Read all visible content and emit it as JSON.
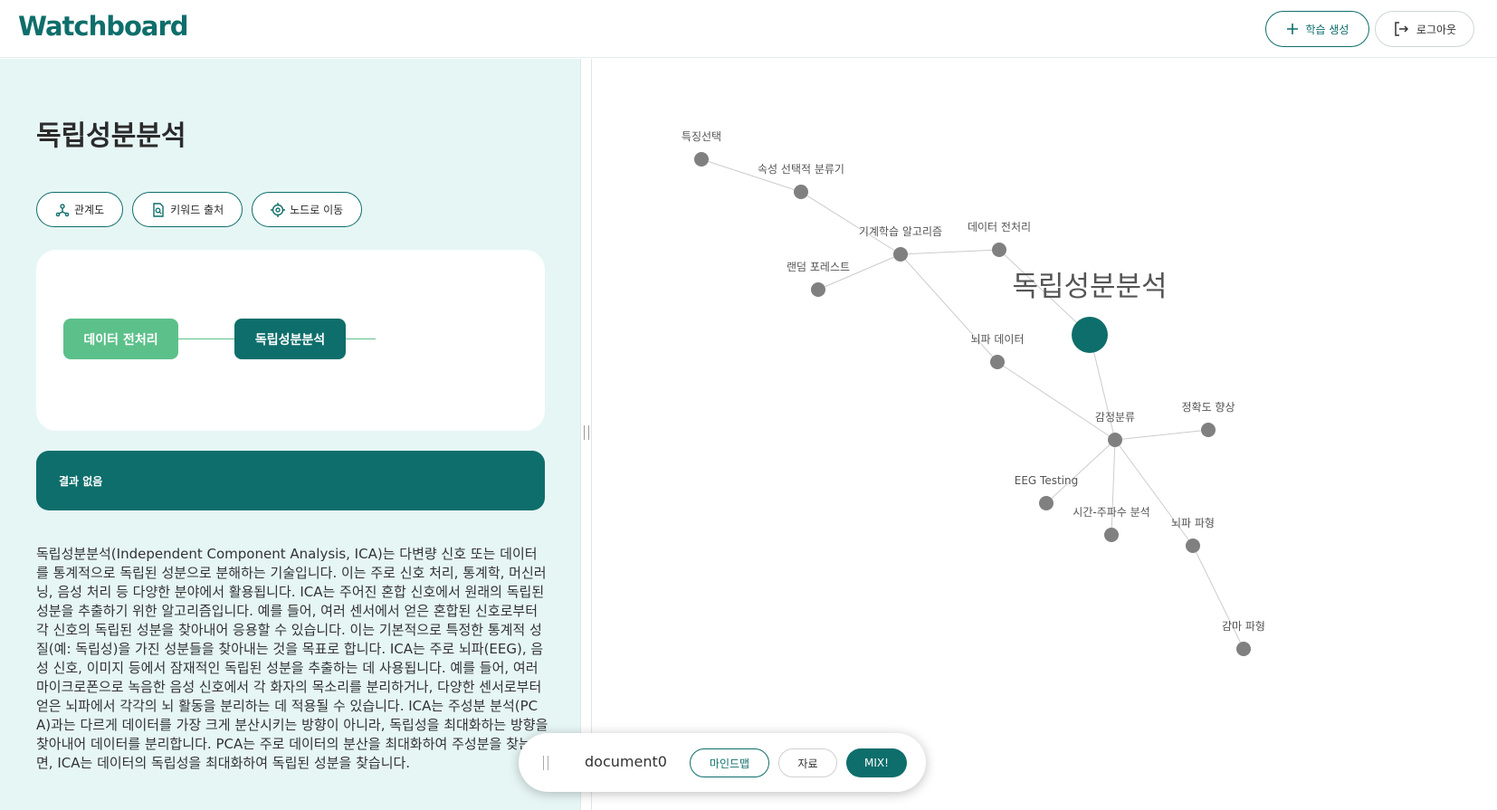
{
  "app": {
    "logo": "Watchboard"
  },
  "header": {
    "create_label": "학습 생성",
    "logout_label": "로그아웃"
  },
  "left": {
    "title": "독립성분분석",
    "actions": [
      {
        "label": "관계도",
        "icon": "hierarchy-icon"
      },
      {
        "label": "키워드 출처",
        "icon": "document-search-icon"
      },
      {
        "label": "노드로 이동",
        "icon": "target-icon"
      }
    ],
    "mindmap": {
      "parent": "데이터 전처리",
      "current": "독립성분분석"
    },
    "result_text": "결과 없음",
    "description": "독립성분분석(Independent Component Analysis, ICA)는 다변량 신호 또는 데이터를 통계적으로 독립된 성분으로 분해하는 기술입니다. 이는 주로 신호 처리, 통계학, 머신러닝, 음성 처리 등 다양한 분야에서 활용됩니다. ICA는 주어진 혼합 신호에서 원래의 독립된 성분을 추출하기 위한 알고리즘입니다. 예를 들어, 여러 센서에서 얻은 혼합된 신호로부터 각 신호의 독립된 성분을 찾아내어 응용할 수 있습니다. 이는 기본적으로 특정한 통계적 성질(예: 독립성)을 가진 성분들을 찾아내는 것을 목표로 합니다. ICA는 주로 뇌파(EEG), 음성 신호, 이미지 등에서 잠재적인 독립된 성분을 추출하는 데 사용됩니다. 예를 들어, 여러 마이크로폰으로 녹음한 음성 신호에서 각 화자의 목소리를 분리하거나, 다양한 센서로부터 얻은 뇌파에서 각각의 뇌 활동을 분리하는 데 적용될 수 있습니다. ICA는 주성분 분석(PCA)과는 다르게 데이터를 가장 크게 분산시키는 방향이 아니라, 독립성을 최대화하는 방향을 찾아내어 데이터를 분리합니다. PCA는 주로 데이터의 분산을 최대화하여 주성분을 찾는 반면, ICA는 데이터의 독립성을 최대화하여 독립된 성분을 찾습니다."
  },
  "graph": {
    "node_color": "#808080",
    "edge_color": "#cccccc",
    "focus_color": "#0e6e6b",
    "focus_label": "독립성분분석",
    "nodes": [
      {
        "id": "n1",
        "label": "특징선택"
      },
      {
        "id": "n2",
        "label": "속성 선택적 분류기"
      },
      {
        "id": "n3",
        "label": "기계학습 알고리즘"
      },
      {
        "id": "n4",
        "label": "데이터 전처리"
      },
      {
        "id": "n5",
        "label": "랜덤 포레스트"
      },
      {
        "id": "n6",
        "label": "뇌파 데이터"
      },
      {
        "id": "n7",
        "label": "감정분류"
      },
      {
        "id": "n8",
        "label": "정확도 향상"
      },
      {
        "id": "n9",
        "label": "EEG Testing"
      },
      {
        "id": "n10",
        "label": "시간-주파수 분석"
      },
      {
        "id": "n11",
        "label": "뇌파 파형"
      },
      {
        "id": "n12",
        "label": "감마 파형"
      }
    ],
    "edges": [
      [
        "n1",
        "n2"
      ],
      [
        "n2",
        "n3"
      ],
      [
        "n3",
        "n4"
      ],
      [
        "n3",
        "n5"
      ],
      [
        "n3",
        "n6"
      ],
      [
        "n4",
        "focus"
      ],
      [
        "n6",
        "n7"
      ],
      [
        "focus",
        "n7"
      ],
      [
        "n7",
        "n8"
      ],
      [
        "n7",
        "n9"
      ],
      [
        "n7",
        "n10"
      ],
      [
        "n7",
        "n11"
      ],
      [
        "n11",
        "n12"
      ]
    ]
  },
  "bottombar": {
    "document_name": "document0",
    "mindmap_label": "마인드맵",
    "material_label": "자료",
    "mix_label": "MIX!"
  }
}
